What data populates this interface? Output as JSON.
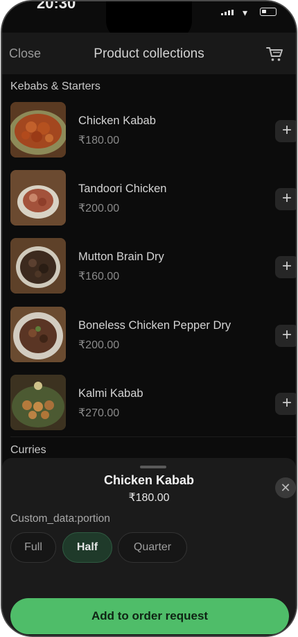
{
  "status_bar": {
    "time": "20:30"
  },
  "header": {
    "close_label": "Close",
    "title": "Product collections",
    "cart_icon": "cart-icon"
  },
  "sections": [
    {
      "title": "Kebabs & Starters"
    },
    {
      "title": "Curries"
    }
  ],
  "items": [
    {
      "name": "Chicken Kabab",
      "price": "₹180.00",
      "image_icon": "dish-image"
    },
    {
      "name": "Tandoori Chicken",
      "price": "₹200.00",
      "image_icon": "dish-image"
    },
    {
      "name": "Mutton Brain Dry",
      "price": "₹160.00",
      "image_icon": "dish-image"
    },
    {
      "name": "Boneless Chicken Pepper Dry",
      "price": "₹200.00",
      "image_icon": "dish-image"
    },
    {
      "name": "Kalmi Kabab",
      "price": "₹270.00",
      "image_icon": "dish-image"
    }
  ],
  "add_button": {
    "label": "+"
  },
  "sheet": {
    "title": "Chicken Kabab",
    "price": "₹180.00",
    "close_label": "✕",
    "option_label": "Custom_data:portion",
    "options": [
      {
        "label": "Full",
        "selected": false
      },
      {
        "label": "Half",
        "selected": true
      },
      {
        "label": "Quarter",
        "selected": false
      }
    ],
    "cta_label": "Add to order request"
  },
  "colors": {
    "accent": "#4fbd69",
    "selected_chip": "#1f3a2a"
  }
}
